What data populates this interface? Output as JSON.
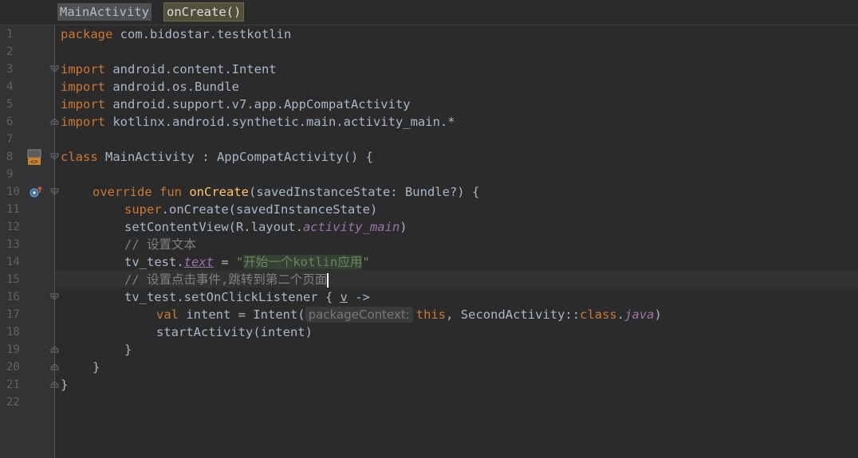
{
  "breadcrumb": {
    "class_name": "MainActivity",
    "function_name": "onCreate()"
  },
  "colors": {
    "background": "#2b2b2b",
    "gutter": "#313335",
    "keyword": "#cc7832",
    "function": "#ffc66d",
    "string": "#6a8759",
    "comment": "#808080",
    "property": "#9876aa"
  },
  "line_numbers": [
    "1",
    "2",
    "3",
    "4",
    "5",
    "6",
    "7",
    "8",
    "9",
    "10",
    "11",
    "12",
    "13",
    "14",
    "15",
    "16",
    "17",
    "18",
    "19",
    "20",
    "21",
    "22"
  ],
  "code": {
    "l1_kw": "package",
    "l1_rest": " com.bidostar.testkotlin",
    "l3_kw": "import",
    "l3_rest": " android.content.Intent",
    "l4_kw": "import",
    "l4_rest": " android.os.Bundle",
    "l5_kw": "import",
    "l5_rest": " android.support.v7.app.AppCompatActivity",
    "l6_kw": "import",
    "l6_rest": " kotlinx.android.synthetic.main.activity_main.*",
    "l8_kw": "class",
    "l8_rest": " MainActivity : AppCompatActivity() {",
    "l10_kw": "override fun",
    "l10_fn": "onCreate",
    "l10_rest": "(savedInstanceState: Bundle?) {",
    "l11_kw": "super",
    "l11_rest": ".onCreate(savedInstanceState)",
    "l12_pre": "setContentView(R.layout.",
    "l12_ital": "activity_main",
    "l12_post": ")",
    "l13_comment": "// 设置文本",
    "l14_pre": "tv_test.",
    "l14_prop": "text",
    "l14_mid": " = ",
    "l14_q1": "\"",
    "l14_str": "开始一个kotlin应用",
    "l14_q2": "\"",
    "l15_comment": "// 设置点击事件,跳转到第二个页面",
    "l16_pre": "tv_test.setOnClickListener { ",
    "l16_v": "v",
    "l16_post": " ->",
    "l17_kw": "val",
    "l17_pre": " intent = Intent(",
    "l17_hint": "packageContext:",
    "l17_this": "this",
    "l17_mid": ", SecondActivity::",
    "l17_class": "class",
    "l17_dot": ".",
    "l17_java": "java",
    "l17_post": ")",
    "l18": "startActivity(intent)",
    "l19": "}",
    "l20": "}",
    "l21": "}"
  },
  "gutter_icons": {
    "line8": "class-marker-icon",
    "line10": "override-marker-icon"
  }
}
